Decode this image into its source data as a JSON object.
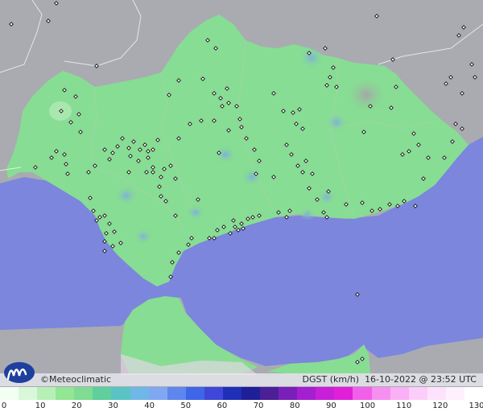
{
  "credit": {
    "copyright_symbol": "©",
    "brand": "Meteoclimatic"
  },
  "caption": {
    "variable": "DGST (km/h)",
    "datetime": "16-10-2022 @ 23:52 UTC"
  },
  "scale": {
    "labels": [
      "0",
      "10",
      "20",
      "30",
      "40",
      "50",
      "60",
      "70",
      "80",
      "90",
      "100",
      "110",
      "120",
      "130"
    ],
    "colors": [
      "#f2fff2",
      "#d9f8d9",
      "#b7f0b7",
      "#93e693",
      "#7fdc92",
      "#5fcf9b",
      "#5ac4c4",
      "#6fb7e6",
      "#7fa7f2",
      "#5f86ee",
      "#3f66e8",
      "#3f47d8",
      "#1f2fb8",
      "#1f1f98",
      "#4a1f98",
      "#7a1fb8",
      "#a41fd0",
      "#c81fd8",
      "#e21fd8",
      "#f25fe8",
      "#f78ff0",
      "#fab0f4",
      "#fccdf8",
      "#fde2fb",
      "#fff0fd",
      "#ffffff"
    ]
  },
  "colors": {
    "sea": "#7b86dc",
    "land_outside": "#a9abb1",
    "region": "#87dd93",
    "station": "#111111"
  }
}
